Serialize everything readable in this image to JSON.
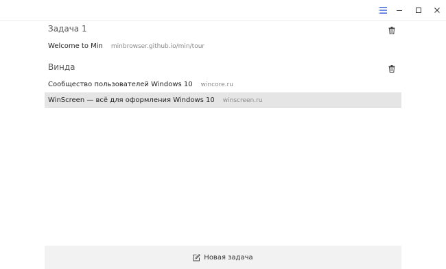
{
  "window": {
    "icons": {
      "tasks": "list-icon",
      "minimize": "minimize-icon",
      "maximize": "maximize-icon",
      "close": "close-icon"
    },
    "accent": "#4a6ee0"
  },
  "tasks": [
    {
      "name": "Задача 1",
      "tabs": [
        {
          "title": "Welcome to Min",
          "url": "minbrowser.github.io/min/tour",
          "selected": false
        }
      ]
    },
    {
      "name": "Винда",
      "tabs": [
        {
          "title": "Сообщество пользователей Windows 10",
          "url": "wincore.ru",
          "selected": false
        },
        {
          "title": "WinScreen — всё для оформления Windows 10",
          "url": "winscreen.ru",
          "selected": true
        }
      ]
    }
  ],
  "new_task": {
    "label": "Новая задача",
    "icon": "edit-icon"
  }
}
